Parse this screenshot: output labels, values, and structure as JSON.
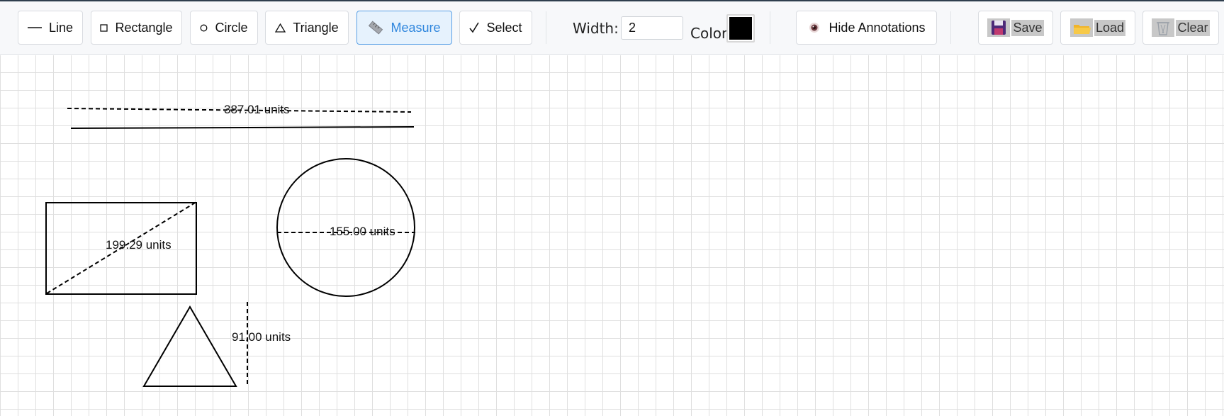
{
  "toolbar": {
    "tools": [
      {
        "label": "Line",
        "icon": "line-icon"
      },
      {
        "label": "Rectangle",
        "icon": "rectangle-icon"
      },
      {
        "label": "Circle",
        "icon": "circle-icon"
      },
      {
        "label": "Triangle",
        "icon": "triangle-icon"
      },
      {
        "label": "Measure",
        "icon": "ruler-icon",
        "active": true
      },
      {
        "label": "Select",
        "icon": "checkmark-icon"
      }
    ],
    "width_label": "Width:",
    "width_value": "2",
    "color_label": "Color:",
    "color_value": "#000000",
    "annotations_label": "Hide Annotations",
    "save_label": "Save",
    "load_label": "Load",
    "clear_label": "Clear"
  },
  "canvas": {
    "measurements": [
      {
        "label": "387.01 units"
      },
      {
        "label": "199.29 units"
      },
      {
        "label": "155.00 units"
      },
      {
        "label": "91.00 units"
      }
    ]
  },
  "colors": {
    "active_tool": "#2f86dd",
    "active_bg": "#e6f2fd",
    "grid": "#dfdfdf",
    "stroke": "#000000"
  }
}
